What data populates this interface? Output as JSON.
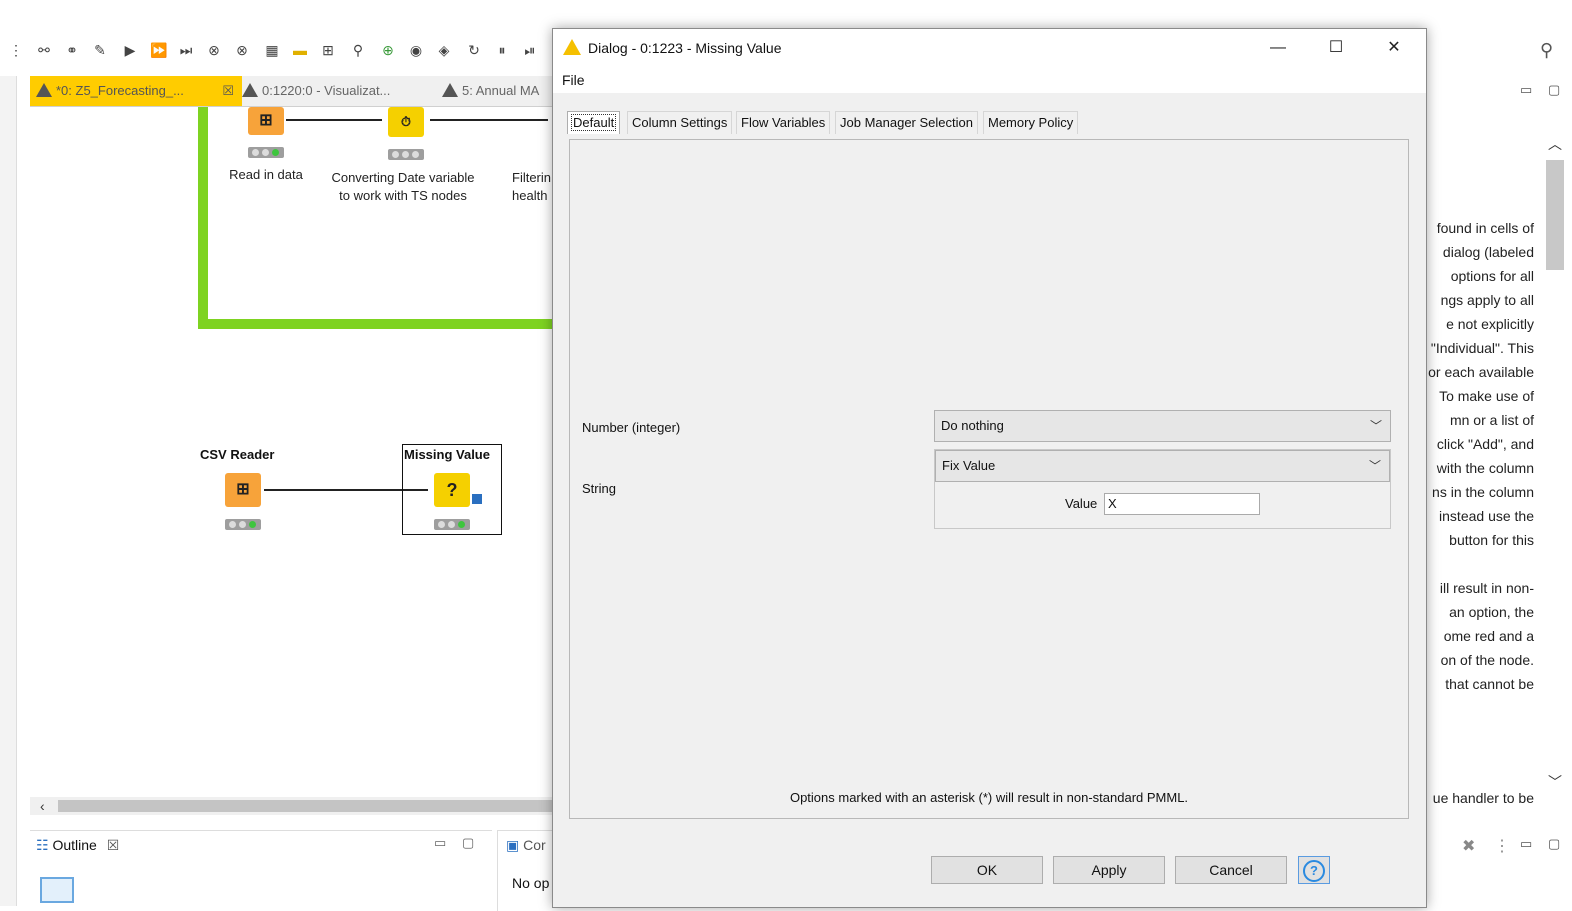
{
  "editor_tabs": [
    {
      "label": "*0: Z5_Forecasting_...",
      "active": true
    },
    {
      "label": "0:1220:0 - Visualizat..."
    },
    {
      "label": "5: Annual MA"
    }
  ],
  "workflow": {
    "top_nodes": [
      {
        "label": "Read in data"
      },
      {
        "label_lines": [
          "Converting Date variable",
          "to work with TS nodes"
        ]
      },
      {
        "label_lines": [
          "Filterin",
          "health"
        ]
      }
    ],
    "csv_reader": {
      "title": "CSV Reader"
    },
    "missing_value": {
      "title": "Missing Value",
      "glyph": "?"
    }
  },
  "outline": {
    "title": "Outline"
  },
  "console": {
    "title": "Cor",
    "text": "No op"
  },
  "description_fragments": [
    "found in cells of",
    "dialog (labeled",
    "options for all",
    "ngs apply to all",
    "e not explicitly",
    "\"Individual\". This",
    "or each available",
    "To make use of",
    "mn or a list of",
    "click \"Add\", and",
    "with the column",
    "ns in the column",
    "instead use the",
    "button for this",
    "ill result in non-",
    "an option, the",
    "ome red and a",
    "on of the node.",
    "that cannot be",
    "ue handler to be"
  ],
  "dialog": {
    "title": "Dialog - 0:1223 - Missing Value",
    "menu_file": "File",
    "window_buttons": {
      "minimize": "—",
      "maximize": "☐",
      "close": "✕"
    },
    "tabs": [
      "Default",
      "Column Settings",
      "Flow Variables",
      "Job Manager Selection",
      "Memory Policy"
    ],
    "selected_tab": "Default",
    "fields": {
      "number_integer": {
        "label": "Number (integer)",
        "value": "Do nothing"
      },
      "string": {
        "label": "String",
        "value": "Fix Value",
        "sub_label": "Value",
        "sub_value": "X"
      }
    },
    "footnote": "Options marked with an asterisk (*) will result in non-standard PMML.",
    "buttons": {
      "ok": "OK",
      "apply": "Apply",
      "cancel": "Cancel",
      "help": "?"
    }
  },
  "colors": {
    "accent_tab": "#ffcc00",
    "node_orange": "#f7a33a",
    "node_yellow": "#f5d000",
    "metanode_border": "#7ed321"
  }
}
